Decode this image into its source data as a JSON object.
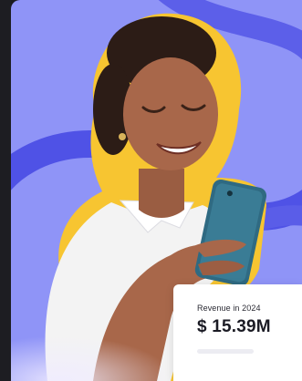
{
  "revenue_card": {
    "label": "Revenue in 2024",
    "value": "$ 15.39M"
  },
  "colors": {
    "background": "#8f94f7",
    "swirl": "#4f52e6",
    "outline": "#f7c531",
    "phone": "#2f6a82",
    "shirt": "#f3f3f3",
    "skin": "#a8674a",
    "hair": "#2c1c16"
  }
}
